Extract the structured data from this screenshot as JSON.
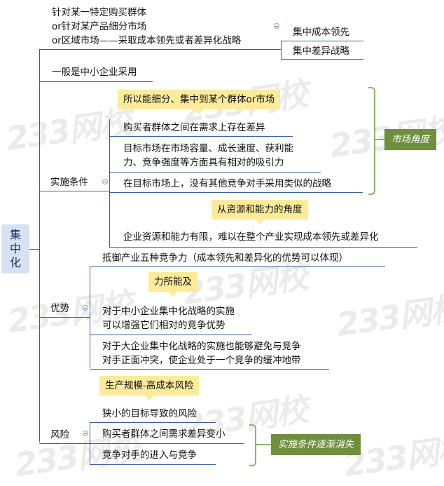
{
  "watermark": "233网校",
  "root": {
    "chars": [
      "集",
      "中",
      "化"
    ]
  },
  "intro": {
    "lines": [
      "针对某一特定购买群体",
      "or针对某产品细分市场",
      "or区域市场——采取成本领先或者差异化战略"
    ],
    "options": [
      "集中成本领先",
      "集中差异战略"
    ]
  },
  "general": "一般是中小企业采用",
  "conditions": {
    "label": "实施条件",
    "market_callout": "所以能细分、集中到某个群体or市场",
    "items": [
      "购买者群体之间在需求上存在差异",
      "目标市场在市场容量、成长速度、获利能",
      "力、竞争强度等方面具有相对的吸引力",
      "在目标市场上，没有其他竞争对手采用类似的战略"
    ],
    "market_tag": "市场角度",
    "resource_callout": "从资源和能力的角度",
    "resource_item": "企业资源和能力有限，难以在整个产业实现成本领先或差异化"
  },
  "advantages": {
    "label": "优势",
    "item1": "抵御产业五种竞争力（成本领先和差异化的优势可以体现）",
    "callout": "力所能及",
    "item2": [
      "对于中小企业集中化战略的实施",
      "可以增强它们相对的竞争优势"
    ],
    "item3": [
      "对于大企业集中化战略的实施也能够避免与竞争",
      "对手正面冲突，使企业处于一个竞争的缓冲地带"
    ]
  },
  "risks": {
    "label": "风险",
    "callout": "生产规模-高成本风险",
    "items": [
      "狭小的目标导致的风险",
      "购买者群体之间需求差异变小",
      "竞争对手的进入与竞争"
    ],
    "tag": "实施条件逐渐消失"
  },
  "colors": {
    "line": "#3a5f9a",
    "root_bg": "#d4e2f1",
    "callout_bg": "#fbeb9a",
    "tag_bg": "#6f8f3d",
    "brace": "#8fb26a"
  }
}
